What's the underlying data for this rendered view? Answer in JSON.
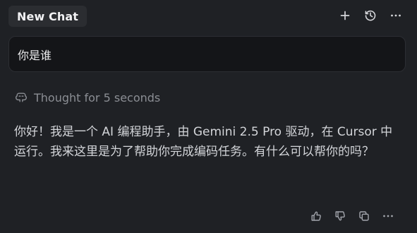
{
  "header": {
    "tab_title": "New Chat",
    "icons": [
      "plus-icon",
      "history-icon",
      "more-icon"
    ]
  },
  "prompt": {
    "text": "你是谁"
  },
  "thought": {
    "label": "Thought for 5 seconds",
    "icon": "brain-icon"
  },
  "response": {
    "text": "你好！我是一个 AI 编程助手，由 Gemini 2.5 Pro 驱动，在 Cursor 中运行。我来这里是为了帮助你完成编码任务。有什么可以帮你的吗？"
  },
  "footer": {
    "icons": [
      "thumbs-up-icon",
      "thumbs-down-icon",
      "copy-icon",
      "more-icon"
    ]
  },
  "colors": {
    "background": "#1f2125",
    "tab_bg": "#2b2d31",
    "prompt_bg": "#141518",
    "muted_text": "#8b8e94",
    "body_text": "#d3d5d9"
  }
}
